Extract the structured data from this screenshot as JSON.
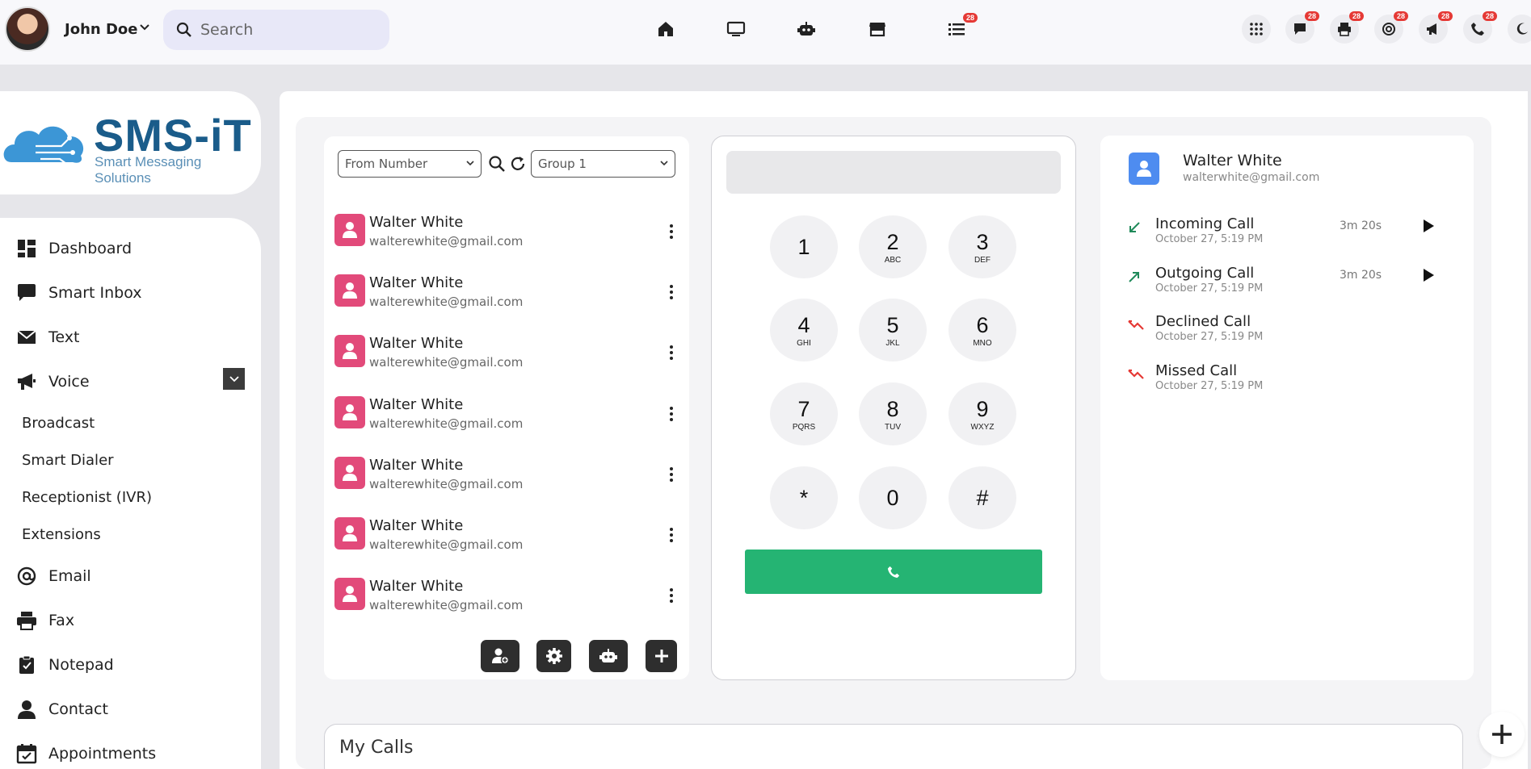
{
  "user": {
    "name": "John Doe"
  },
  "search": {
    "placeholder": "Search"
  },
  "topnav": {
    "tasks_badge": "28",
    "right_badges": [
      "28",
      "28",
      "28",
      "28",
      "28"
    ]
  },
  "brand": {
    "title": "SMS-iT",
    "subtitle": "Smart Messaging Solutions"
  },
  "sidebar": {
    "items": [
      {
        "label": "Dashboard",
        "icon": "dashboard-icon"
      },
      {
        "label": "Smart Inbox",
        "icon": "chat-bubble-icon"
      },
      {
        "label": "Text",
        "icon": "envelope-icon"
      },
      {
        "label": "Voice",
        "icon": "megaphone-icon"
      },
      {
        "label": "Email",
        "icon": "at-sign-icon"
      },
      {
        "label": "Fax",
        "icon": "printer-icon"
      },
      {
        "label": "Notepad",
        "icon": "clipboard-icon"
      },
      {
        "label": "Contact",
        "icon": "person-icon"
      },
      {
        "label": "Appointments",
        "icon": "calendar-icon"
      }
    ],
    "voice_sub": [
      "Broadcast",
      "Smart Dialer",
      "Receptionist (IVR)",
      "Extensions"
    ]
  },
  "filters": {
    "from_number": "From Number",
    "group": "Group 1"
  },
  "contacts": [
    {
      "name": "Walter White",
      "email": "walterewhite@gmail.com"
    },
    {
      "name": "Walter White",
      "email": "walterewhite@gmail.com"
    },
    {
      "name": "Walter White",
      "email": "walterewhite@gmail.com"
    },
    {
      "name": "Walter White",
      "email": "walterewhite@gmail.com"
    },
    {
      "name": "Walter White",
      "email": "walterewhite@gmail.com"
    },
    {
      "name": "Walter White",
      "email": "walterewhite@gmail.com"
    },
    {
      "name": "Walter White",
      "email": "walterewhite@gmail.com"
    }
  ],
  "dialpad": {
    "keys": [
      {
        "digit": "1",
        "letters": ""
      },
      {
        "digit": "2",
        "letters": "ABC"
      },
      {
        "digit": "3",
        "letters": "DEF"
      },
      {
        "digit": "4",
        "letters": "GHI"
      },
      {
        "digit": "5",
        "letters": "JKL"
      },
      {
        "digit": "6",
        "letters": "MNO"
      },
      {
        "digit": "7",
        "letters": "PQRS"
      },
      {
        "digit": "8",
        "letters": "TUV"
      },
      {
        "digit": "9",
        "letters": "WXYZ"
      },
      {
        "digit": "*",
        "letters": ""
      },
      {
        "digit": "0",
        "letters": ""
      },
      {
        "digit": "#",
        "letters": ""
      }
    ],
    "call_color": "#25b473"
  },
  "history": {
    "contact_name": "Walter White",
    "contact_email": "walterwhite@gmail.com",
    "calls": [
      {
        "type": "Incoming Call",
        "date": "October 27, 5:19 PM",
        "duration": "3m 20s",
        "icon": "incoming-arrow-icon"
      },
      {
        "type": "Outgoing Call",
        "date": "October 27, 5:19 PM",
        "duration": "3m 20s",
        "icon": "outgoing-arrow-icon"
      },
      {
        "type": "Declined Call",
        "date": "October 27, 5:19 PM",
        "duration": "",
        "icon": "declined-call-icon"
      },
      {
        "type": "Missed Call",
        "date": "October 27, 5:19 PM",
        "duration": "",
        "icon": "missed-call-icon"
      }
    ]
  },
  "my_calls": {
    "title": "My Calls"
  }
}
